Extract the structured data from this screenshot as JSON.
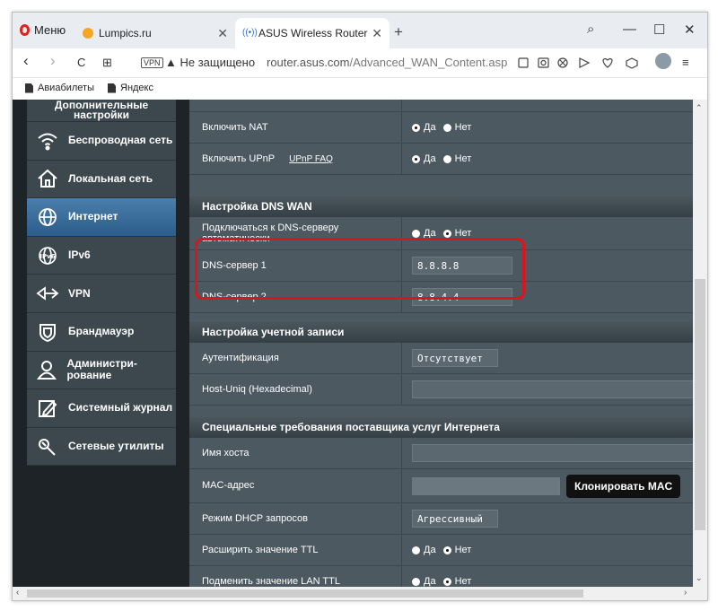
{
  "browser": {
    "menu_label": "Меню",
    "tabs": [
      {
        "label": "Lumpics.ru",
        "close": "✕"
      },
      {
        "label": "ASUS Wireless Router RT-N",
        "close": "✕"
      }
    ],
    "new_tab": "+",
    "window_controls": {
      "search": "⌕",
      "minimize": "—",
      "maximize": "☐",
      "close": "✕"
    },
    "nav": {
      "back": "‹",
      "forward": "›",
      "reload": "C",
      "speed_dial": "⊞"
    },
    "vpn_badge": "VPN",
    "security_warning": "▲ Не защищено",
    "url_host": "router.asus.com",
    "url_path": "/Advanced_WAN_Content.asp",
    "bookmarks": [
      "Авиабилеты",
      "Яндекс"
    ]
  },
  "sidebar": {
    "header": "Дополнительные настройки",
    "items": [
      {
        "label": "Беспроводная сеть",
        "icon": "wifi-icon"
      },
      {
        "label": "Локальная сеть",
        "icon": "home-icon"
      },
      {
        "label": "Интернет",
        "icon": "globe-icon",
        "active": true
      },
      {
        "label": "IPv6",
        "icon": "ipv6-icon"
      },
      {
        "label": "VPN",
        "icon": "vpn-icon"
      },
      {
        "label": "Брандмауэр",
        "icon": "shield-icon"
      },
      {
        "label": "Администри-рование",
        "icon": "user-icon"
      },
      {
        "label": "Системный журнал",
        "icon": "log-icon"
      },
      {
        "label": "Сетевые утилиты",
        "icon": "tools-icon"
      }
    ]
  },
  "wan": {
    "nat": {
      "label": "Включить NAT",
      "yes": "Да",
      "no": "Нет"
    },
    "upnp": {
      "label": "Включить UPnP",
      "faq": "UPnP FAQ",
      "yes": "Да",
      "no": "Нет"
    },
    "dns_section": "Настройка DNS WAN",
    "dns_auto": {
      "label": "Подключаться к DNS-серверу автоматически",
      "yes": "Да",
      "no": "Нет"
    },
    "dns1": {
      "label": "DNS-сервер 1",
      "value": "8.8.8.8"
    },
    "dns2": {
      "label": "DNS-сервер 2",
      "value": "8.8.4.4"
    },
    "account_section": "Настройка учетной записи",
    "auth": {
      "label": "Аутентификация",
      "value": "Отсутствует"
    },
    "host_uniq": {
      "label": "Host-Uniq (Hexadecimal)",
      "value": ""
    },
    "isp_section": "Специальные требования поставщика услуг Интернета",
    "hostname": {
      "label": "Имя хоста",
      "value": ""
    },
    "mac": {
      "label": "MAC-адрес",
      "button": "Клонировать MAC"
    },
    "dhcp": {
      "label": "Режим DHCP запросов",
      "value": "Агрессивный"
    },
    "ttl": {
      "label": "Расширить значение TTL",
      "yes": "Да",
      "no": "Нет"
    },
    "lan_ttl": {
      "label": "Подменить значение LAN TTL",
      "yes": "Да",
      "no": "Нет"
    }
  }
}
